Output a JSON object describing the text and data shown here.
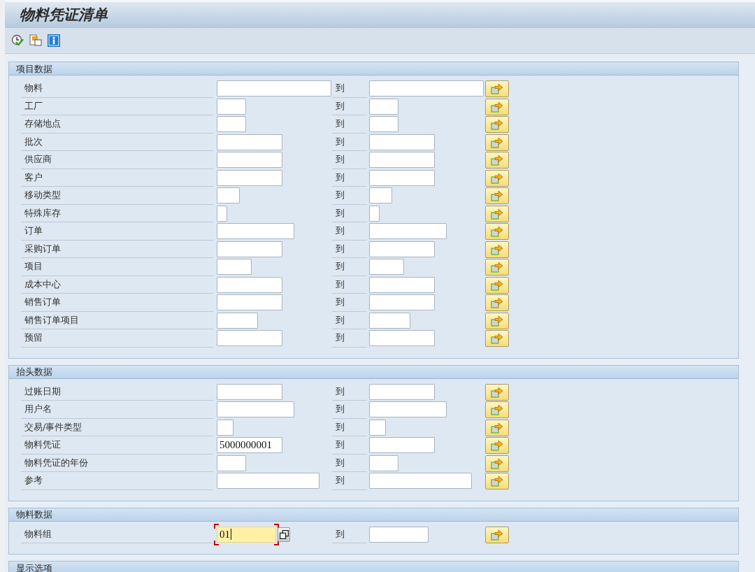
{
  "window": {
    "title": "物料凭证清单"
  },
  "sections": [
    {
      "title": "项目数据",
      "rows": [
        {
          "label": "物料",
          "to_label": "到",
          "focused": false
        },
        {
          "label": "工厂",
          "to_label": "到",
          "focused": false
        },
        {
          "label": "存储地点",
          "to_label": "到",
          "focused": false
        },
        {
          "label": "批次",
          "to_label": "到",
          "focused": false
        },
        {
          "label": "供应商",
          "to_label": "到",
          "focused": false
        },
        {
          "label": "客户",
          "to_label": "到",
          "focused": false
        },
        {
          "label": "移动类型",
          "to_label": "到",
          "focused": false
        },
        {
          "label": "特殊库存",
          "to_label": "到",
          "focused": false
        },
        {
          "label": "订单",
          "to_label": "到",
          "focused": false
        },
        {
          "label": "采购订单",
          "to_label": "到",
          "focused": false
        },
        {
          "label": "项目",
          "to_label": "到",
          "focused": false
        },
        {
          "label": "成本中心",
          "to_label": "到",
          "focused": false
        },
        {
          "label": "销售订单",
          "to_label": "到",
          "focused": false
        },
        {
          "label": "销售订单项目",
          "to_label": "到",
          "focused": false
        },
        {
          "label": "预留",
          "to_label": "到",
          "focused": false
        }
      ]
    },
    {
      "title": "抬头数据",
      "rows": [
        {
          "label": "过账日期",
          "to_label": "到",
          "focused": false
        },
        {
          "label": "用户名",
          "to_label": "到",
          "focused": false
        },
        {
          "label": "交易/事件类型",
          "to_label": "到",
          "focused": false
        },
        {
          "label": "物料凭证",
          "from": "5000000001",
          "to_label": "到",
          "focused": false
        },
        {
          "label": "物料凭证的年份",
          "to_label": "到",
          "focused": false
        },
        {
          "label": "参考",
          "to_label": "到",
          "focused": false
        }
      ]
    },
    {
      "title": "物料数据",
      "rows": [
        {
          "label": "物料组",
          "from": "01",
          "to_label": "到",
          "focused": true
        }
      ]
    },
    {
      "title": "显示选项"
    }
  ]
}
